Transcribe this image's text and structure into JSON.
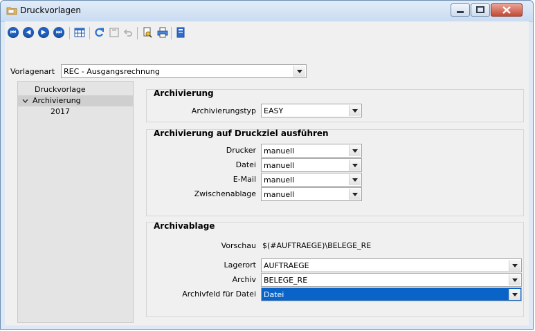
{
  "window": {
    "title": "Druckvorlagen"
  },
  "toolbar": {
    "icons": [
      "first-record-icon",
      "previous-record-icon",
      "next-record-icon",
      "last-record-icon",
      "table-view-icon",
      "refresh-icon",
      "save-icon",
      "undo-icon",
      "print-preview-icon",
      "print-icon",
      "export-icon"
    ]
  },
  "vorlagenart": {
    "label": "Vorlagenart",
    "value": "REC - Ausgangsrechnung"
  },
  "tree": {
    "items": [
      {
        "label": "Druckvorlage"
      },
      {
        "label": "Archivierung"
      },
      {
        "label": "2017"
      }
    ]
  },
  "archivierung": {
    "title": "Archivierung",
    "typ_label": "Archivierungstyp",
    "typ_value": "EASY"
  },
  "druckziel": {
    "title": "Archivierung auf Druckziel ausführen",
    "rows": [
      {
        "label": "Drucker",
        "value": "manuell"
      },
      {
        "label": "Datei",
        "value": "manuell"
      },
      {
        "label": "E-Mail",
        "value": "manuell"
      },
      {
        "label": "Zwischenablage",
        "value": "manuell"
      }
    ]
  },
  "archivablage": {
    "title": "Archivablage",
    "vorschau_label": "Vorschau",
    "vorschau_value": "$(#AUFTRAEGE)\\BELEGE_RE",
    "lagerort_label": "Lagerort",
    "lagerort_value": "AUFTRAEGE",
    "archiv_label": "Archiv",
    "archiv_value": "BELEGE_RE",
    "archivfeld_label": "Archivfeld für Datei",
    "archivfeld_value": "Datei"
  },
  "colors": {
    "selection": "#0a64c8",
    "nav_icon": "#1f5fbf",
    "close_button": "#c54a36"
  }
}
